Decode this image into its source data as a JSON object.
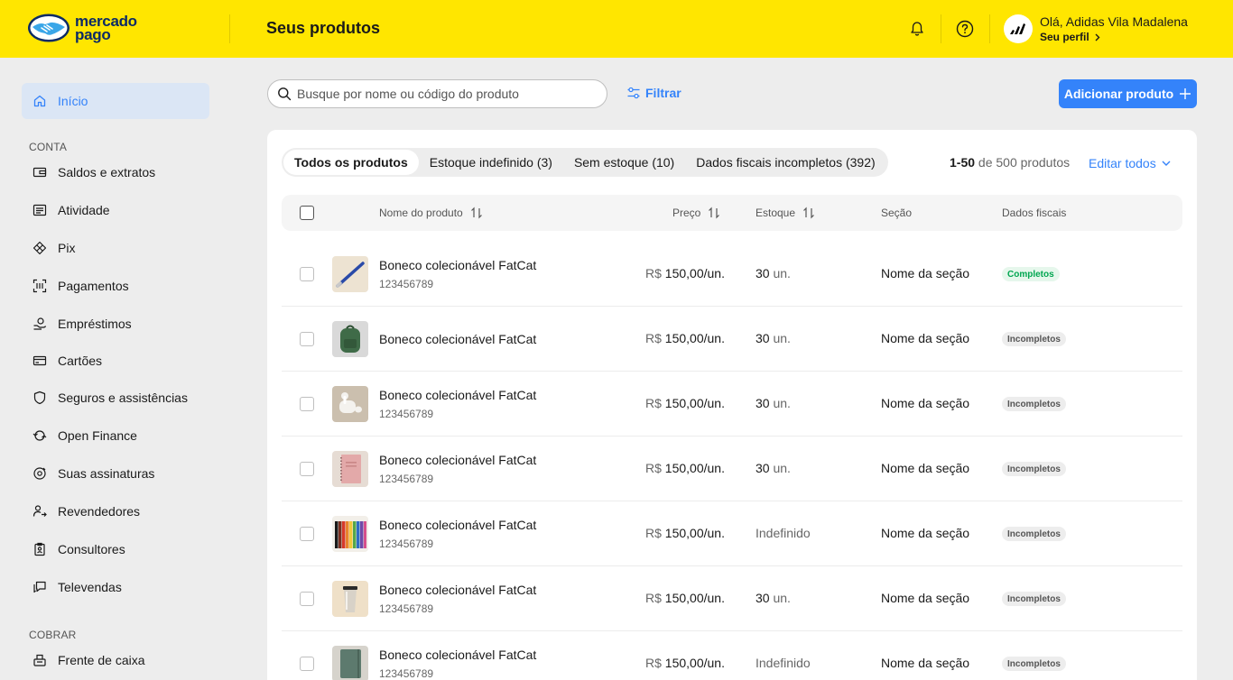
{
  "brand": {
    "logo_text_line1": "mercado",
    "logo_text_line2": "pago",
    "accent": "#ffe600",
    "link_color": "#3483fa"
  },
  "header": {
    "title": "Seus produtos",
    "greeting": "Olá, Adidas Vila Madalena",
    "profile_link": "Seu perfil"
  },
  "sidebar": {
    "home": "Início",
    "sections": [
      {
        "title": "CONTA",
        "items": [
          {
            "label": "Saldos e extratos",
            "icon": "wallet-icon"
          },
          {
            "label": "Atividade",
            "icon": "activity-icon"
          },
          {
            "label": "Pix",
            "icon": "pix-icon"
          },
          {
            "label": "Pagamentos",
            "icon": "qr-scan-icon"
          },
          {
            "label": "Empréstimos",
            "icon": "loan-icon"
          },
          {
            "label": "Cartões",
            "icon": "card-icon"
          },
          {
            "label": "Seguros e assistências",
            "icon": "shield-icon"
          },
          {
            "label": "Open Finance",
            "icon": "open-finance-icon"
          },
          {
            "label": "Suas assinaturas",
            "icon": "subscription-icon"
          },
          {
            "label": "Revendedores",
            "icon": "reseller-icon"
          },
          {
            "label": "Consultores",
            "icon": "badge-icon"
          },
          {
            "label": "Televendas",
            "icon": "chat-icon"
          }
        ]
      },
      {
        "title": "COBRAR",
        "items": [
          {
            "label": "Frente de caixa",
            "icon": "cash-register-icon"
          }
        ]
      }
    ]
  },
  "toolbar": {
    "search_placeholder": "Busque por nome ou código do produto",
    "filter_label": "Filtrar",
    "add_label": "Adicionar produto"
  },
  "tabs": [
    {
      "label": "Todos os produtos",
      "active": true
    },
    {
      "label": "Estoque indefinido (3)",
      "active": false
    },
    {
      "label": "Sem estoque (10)",
      "active": false
    },
    {
      "label": "Dados fiscais incompletos (392)",
      "active": false
    }
  ],
  "pagination": {
    "range": "1-50",
    "rest": "de 500 produtos"
  },
  "edit_all": "Editar todos",
  "table": {
    "columns": {
      "name": "Nome do produto",
      "price": "Preço",
      "stock": "Estoque",
      "section": "Seção",
      "fiscal": "Dados fiscais"
    },
    "rows": [
      {
        "name": "Boneco colecionável FatCat",
        "code": "123456789",
        "currency": "R$",
        "price": "150,00/un.",
        "stock_qty": "30",
        "stock_unit": "un.",
        "section": "Nome da seção",
        "fiscal": "Completos",
        "fiscal_ok": true,
        "thumb": "pen"
      },
      {
        "name": "Boneco colecionável FatCat",
        "code": "",
        "currency": "R$",
        "price": "150,00/un.",
        "stock_qty": "30",
        "stock_unit": "un.",
        "section": "Nome da seção",
        "fiscal": "Incompletos",
        "fiscal_ok": false,
        "thumb": "backpack"
      },
      {
        "name": "Boneco colecionável FatCat",
        "code": "123456789",
        "currency": "R$",
        "price": "150,00/un.",
        "stock_qty": "30",
        "stock_unit": "un.",
        "section": "Nome da seção",
        "fiscal": "Incompletos",
        "fiscal_ok": false,
        "thumb": "earbuds"
      },
      {
        "name": "Boneco colecionável FatCat",
        "code": "123456789",
        "currency": "R$",
        "price": "150,00/un.",
        "stock_qty": "30",
        "stock_unit": "un.",
        "section": "Nome da seção",
        "fiscal": "Incompletos",
        "fiscal_ok": false,
        "thumb": "notebook"
      },
      {
        "name": "Boneco colecionável FatCat",
        "code": "123456789",
        "currency": "R$",
        "price": "150,00/un.",
        "stock_qty": "Indefinido",
        "stock_unit": "",
        "section": "Nome da seção",
        "fiscal": "Incompletos",
        "fiscal_ok": false,
        "thumb": "pencils"
      },
      {
        "name": "Boneco colecionável FatCat",
        "code": "123456789",
        "currency": "R$",
        "price": "150,00/un.",
        "stock_qty": "30",
        "stock_unit": "un.",
        "section": "Nome da seção",
        "fiscal": "Incompletos",
        "fiscal_ok": false,
        "thumb": "tumbler"
      },
      {
        "name": "Boneco colecionável FatCat",
        "code": "123456789",
        "currency": "R$",
        "price": "150,00/un.",
        "stock_qty": "Indefinido",
        "stock_unit": "",
        "section": "Nome da seção",
        "fiscal": "Incompletos",
        "fiscal_ok": false,
        "thumb": "journal"
      }
    ]
  }
}
